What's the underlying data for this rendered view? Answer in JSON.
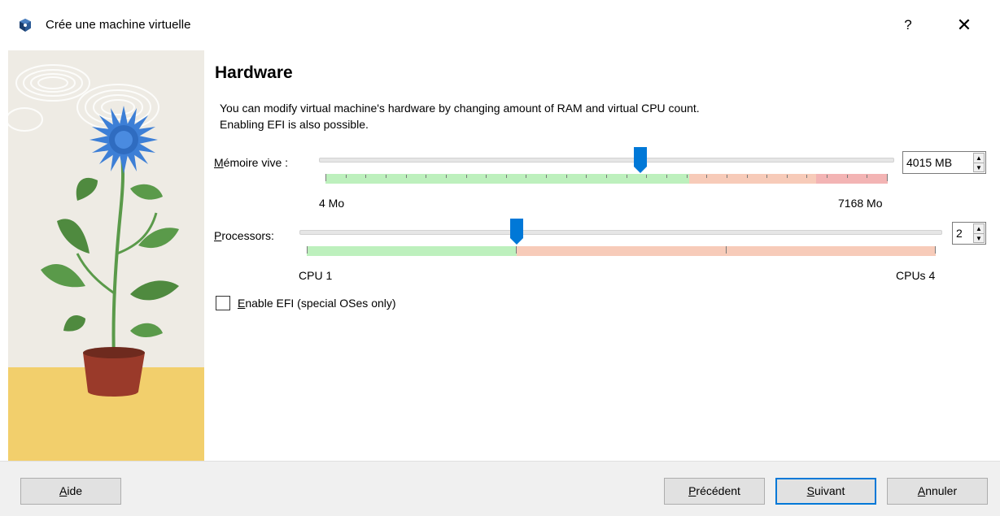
{
  "window": {
    "title": "Crée une machine virtuelle",
    "help_label": "?",
    "close_label": "✕"
  },
  "content": {
    "heading": "Hardware",
    "description_line1": "You can modify virtual machine's hardware by changing amount of RAM and virtual CPU count.",
    "description_line2": "Enabling EFI is also possible."
  },
  "memory": {
    "label_mnemonic": "M",
    "label_rest": "émoire vive :",
    "value": "4015 MB",
    "value_mb": 4015,
    "min_label": "4 Mo",
    "max_label": "7168 Mo",
    "min": 4,
    "max": 7168
  },
  "processors": {
    "label_mnemonic": "P",
    "label_rest": "rocessors:",
    "value": "2",
    "value_num": 2,
    "min_label": "CPU 1",
    "max_label": "CPUs 4",
    "min": 1,
    "max": 4
  },
  "efi": {
    "label_mnemonic": "E",
    "label_rest": "nable EFI (special OSes only)",
    "checked": false
  },
  "buttons": {
    "help_mnemonic": "A",
    "help_rest": "ide",
    "back_mnemonic": "P",
    "back_rest": "récédent",
    "next_mnemonic": "S",
    "next_rest": "uivant",
    "cancel_mnemonic": "A",
    "cancel_rest": "nnuler"
  },
  "colors": {
    "accent": "#0078d7",
    "scale_green": "#bdf0bd",
    "scale_orange": "#f7cbb9",
    "scale_red": "#f3b4b4"
  }
}
